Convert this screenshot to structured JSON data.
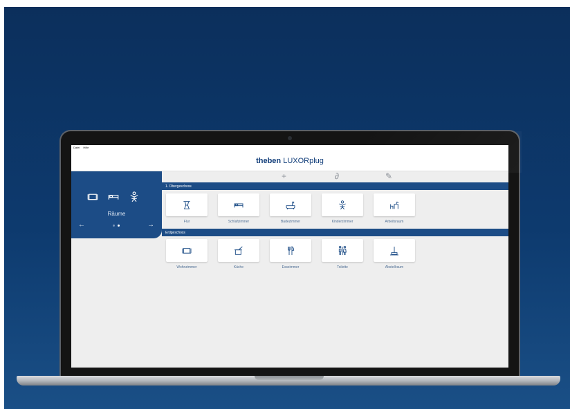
{
  "menu": {
    "items": [
      "Datei",
      "Hilfe"
    ]
  },
  "header": {
    "brand_bold": "theben",
    "brand_light": " LUXORplug"
  },
  "sidebar": {
    "label": "Räume",
    "icons": [
      "living-room-icon",
      "bed-icon",
      "child-icon"
    ],
    "prev_arrow": "←",
    "next_arrow": "→",
    "pages": 2,
    "active_page": 2
  },
  "toolbar": {
    "add": "+",
    "touch": "∂",
    "edit": "✎"
  },
  "sections": [
    {
      "title": "1. Obergeschoss",
      "rooms": [
        {
          "label": "Flur",
          "icon": "hallway-icon"
        },
        {
          "label": "Schlafzimmer",
          "icon": "bed-icon"
        },
        {
          "label": "Badezimmer",
          "icon": "bathtub-icon"
        },
        {
          "label": "Kinderzimmer",
          "icon": "child-icon"
        },
        {
          "label": "Arbeitsraum",
          "icon": "desk-icon"
        }
      ]
    },
    {
      "title": "Erdgeschoss",
      "rooms": [
        {
          "label": "Wohnzimmer",
          "icon": "sofa-icon"
        },
        {
          "label": "Küche",
          "icon": "cooking-pot-icon"
        },
        {
          "label": "Esszimmer",
          "icon": "cutlery-icon"
        },
        {
          "label": "Toilette",
          "icon": "toilet-icon"
        },
        {
          "label": "Abstellraum",
          "icon": "broom-icon"
        }
      ]
    }
  ],
  "colors": {
    "accent": "#1c4c86",
    "background": "#0d3a6e",
    "tile_label": "#4f6f95"
  }
}
